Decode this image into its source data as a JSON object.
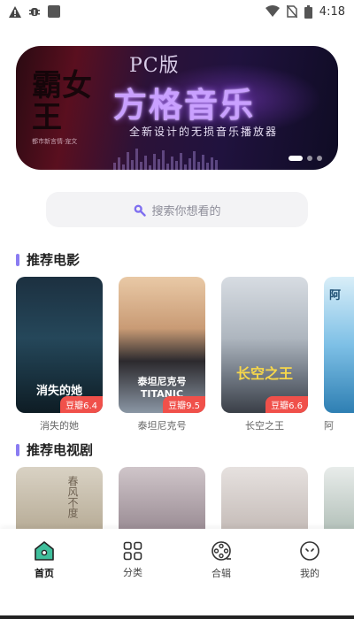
{
  "status": {
    "time": "4:18",
    "icons": [
      "warning-icon",
      "bug-icon",
      "square-icon",
      "wifi-icon",
      "no-sim-icon",
      "battery-icon"
    ]
  },
  "banner": {
    "calligraphy": "霸女王",
    "caption": "都市新言情·宠文",
    "pc_label": "PC版",
    "title": "方格音乐",
    "subtitle": "全新设计的无损音乐播放器",
    "accent": "#c9a0ff"
  },
  "search": {
    "placeholder": "搜索你想看的",
    "icon": "search-icon",
    "accent": "#7f6ff0"
  },
  "sections": {
    "movies": {
      "title": "推荐电影",
      "items": [
        {
          "name": "消失的她",
          "poster_text": "消失的她",
          "rating": "豆瓣6.4"
        },
        {
          "name": "泰坦尼克号",
          "poster_text": "泰坦尼克号 TITANIC",
          "rating": "豆瓣9.5"
        },
        {
          "name": "长空之王",
          "poster_text": "长空之王",
          "rating": "豆瓣6.6"
        },
        {
          "name": "阿",
          "poster_text": "阿",
          "rating": ""
        }
      ]
    },
    "tv": {
      "title": "推荐电视剧",
      "items": [
        {
          "poster_text": "春风不度"
        },
        {
          "poster_text": ""
        },
        {
          "poster_text": ""
        },
        {
          "poster_text": ""
        }
      ]
    }
  },
  "tabs": [
    {
      "label": "首页",
      "icon": "home-icon",
      "active": true
    },
    {
      "label": "分类",
      "icon": "category-grid-icon",
      "active": false
    },
    {
      "label": "合辑",
      "icon": "film-reel-icon",
      "active": false
    },
    {
      "label": "我的",
      "icon": "profile-face-icon",
      "active": false
    }
  ],
  "colors": {
    "rating_badge": "#f0504a",
    "section_bar": "#8a7cf2",
    "home_tab": "#3fbf9c"
  }
}
